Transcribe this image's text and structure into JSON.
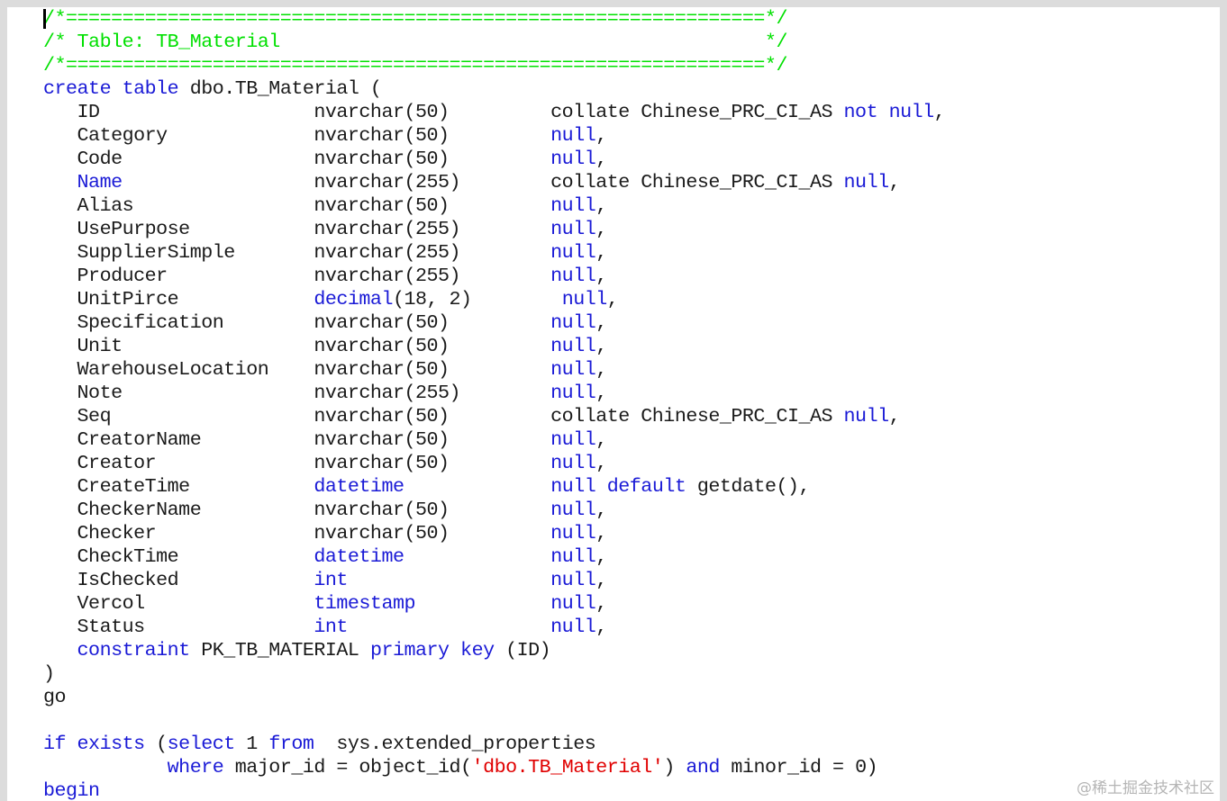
{
  "editor": {
    "watermark": "@稀土掘金技术社区"
  },
  "code_lines": [
    [
      {
        "t": "/*==============================================================*/",
        "c": "comment"
      }
    ],
    [
      {
        "t": "/* Table: TB_Material                                           */",
        "c": "comment"
      }
    ],
    [
      {
        "t": "/*==============================================================*/",
        "c": "comment"
      }
    ],
    [
      {
        "t": "create table",
        "c": "kw"
      },
      {
        "t": " dbo.TB_Material (",
        "c": ""
      }
    ],
    [
      {
        "t": "   ID                   nvarchar(50)         collate Chinese_PRC_CI_AS ",
        "c": ""
      },
      {
        "t": "not null",
        "c": "kw"
      },
      {
        "t": ",",
        "c": ""
      }
    ],
    [
      {
        "t": "   Category             nvarchar(50)         ",
        "c": ""
      },
      {
        "t": "null",
        "c": "kw"
      },
      {
        "t": ",",
        "c": ""
      }
    ],
    [
      {
        "t": "   Code                 nvarchar(50)         ",
        "c": ""
      },
      {
        "t": "null",
        "c": "kw"
      },
      {
        "t": ",",
        "c": ""
      }
    ],
    [
      {
        "t": "   ",
        "c": ""
      },
      {
        "t": "Name",
        "c": "kw"
      },
      {
        "t": "                 nvarchar(255)        collate Chinese_PRC_CI_AS ",
        "c": ""
      },
      {
        "t": "null",
        "c": "kw"
      },
      {
        "t": ",",
        "c": ""
      }
    ],
    [
      {
        "t": "   Alias                nvarchar(50)         ",
        "c": ""
      },
      {
        "t": "null",
        "c": "kw"
      },
      {
        "t": ",",
        "c": ""
      }
    ],
    [
      {
        "t": "   UsePurpose           nvarchar(255)        ",
        "c": ""
      },
      {
        "t": "null",
        "c": "kw"
      },
      {
        "t": ",",
        "c": ""
      }
    ],
    [
      {
        "t": "   SupplierSimple       nvarchar(255)        ",
        "c": ""
      },
      {
        "t": "null",
        "c": "kw"
      },
      {
        "t": ",",
        "c": ""
      }
    ],
    [
      {
        "t": "   Producer             nvarchar(255)        ",
        "c": ""
      },
      {
        "t": "null",
        "c": "kw"
      },
      {
        "t": ",",
        "c": ""
      }
    ],
    [
      {
        "t": "   UnitPirce            ",
        "c": ""
      },
      {
        "t": "decimal",
        "c": "kw"
      },
      {
        "t": "(18, 2)        ",
        "c": ""
      },
      {
        "t": "null",
        "c": "kw"
      },
      {
        "t": ",",
        "c": ""
      }
    ],
    [
      {
        "t": "   Specification        nvarchar(50)         ",
        "c": ""
      },
      {
        "t": "null",
        "c": "kw"
      },
      {
        "t": ",",
        "c": ""
      }
    ],
    [
      {
        "t": "   Unit                 nvarchar(50)         ",
        "c": ""
      },
      {
        "t": "null",
        "c": "kw"
      },
      {
        "t": ",",
        "c": ""
      }
    ],
    [
      {
        "t": "   WarehouseLocation    nvarchar(50)         ",
        "c": ""
      },
      {
        "t": "null",
        "c": "kw"
      },
      {
        "t": ",",
        "c": ""
      }
    ],
    [
      {
        "t": "   Note                 nvarchar(255)        ",
        "c": ""
      },
      {
        "t": "null",
        "c": "kw"
      },
      {
        "t": ",",
        "c": ""
      }
    ],
    [
      {
        "t": "   Seq                  nvarchar(50)         collate Chinese_PRC_CI_AS ",
        "c": ""
      },
      {
        "t": "null",
        "c": "kw"
      },
      {
        "t": ",",
        "c": ""
      }
    ],
    [
      {
        "t": "   CreatorName          nvarchar(50)         ",
        "c": ""
      },
      {
        "t": "null",
        "c": "kw"
      },
      {
        "t": ",",
        "c": ""
      }
    ],
    [
      {
        "t": "   Creator              nvarchar(50)         ",
        "c": ""
      },
      {
        "t": "null",
        "c": "kw"
      },
      {
        "t": ",",
        "c": ""
      }
    ],
    [
      {
        "t": "   CreateTime           ",
        "c": ""
      },
      {
        "t": "datetime",
        "c": "kw"
      },
      {
        "t": "             ",
        "c": ""
      },
      {
        "t": "null default",
        "c": "kw"
      },
      {
        "t": " getdate(),",
        "c": ""
      }
    ],
    [
      {
        "t": "   CheckerName          nvarchar(50)         ",
        "c": ""
      },
      {
        "t": "null",
        "c": "kw"
      },
      {
        "t": ",",
        "c": ""
      }
    ],
    [
      {
        "t": "   Checker              nvarchar(50)         ",
        "c": ""
      },
      {
        "t": "null",
        "c": "kw"
      },
      {
        "t": ",",
        "c": ""
      }
    ],
    [
      {
        "t": "   CheckTime            ",
        "c": ""
      },
      {
        "t": "datetime",
        "c": "kw"
      },
      {
        "t": "             ",
        "c": ""
      },
      {
        "t": "null",
        "c": "kw"
      },
      {
        "t": ",",
        "c": ""
      }
    ],
    [
      {
        "t": "   IsChecked            ",
        "c": ""
      },
      {
        "t": "int",
        "c": "kw"
      },
      {
        "t": "                  ",
        "c": ""
      },
      {
        "t": "null",
        "c": "kw"
      },
      {
        "t": ",",
        "c": ""
      }
    ],
    [
      {
        "t": "   Vercol               ",
        "c": ""
      },
      {
        "t": "timestamp",
        "c": "kw"
      },
      {
        "t": "            ",
        "c": ""
      },
      {
        "t": "null",
        "c": "kw"
      },
      {
        "t": ",",
        "c": ""
      }
    ],
    [
      {
        "t": "   Status               ",
        "c": ""
      },
      {
        "t": "int",
        "c": "kw"
      },
      {
        "t": "                  ",
        "c": ""
      },
      {
        "t": "null",
        "c": "kw"
      },
      {
        "t": ",",
        "c": ""
      }
    ],
    [
      {
        "t": "   ",
        "c": ""
      },
      {
        "t": "constraint",
        "c": "kw"
      },
      {
        "t": " PK_TB_MATERIAL ",
        "c": ""
      },
      {
        "t": "primary key",
        "c": "kw"
      },
      {
        "t": " (ID)",
        "c": ""
      }
    ],
    [
      {
        "t": ")",
        "c": ""
      }
    ],
    [
      {
        "t": "go",
        "c": ""
      }
    ],
    [
      {
        "t": "",
        "c": ""
      }
    ],
    [
      {
        "t": "if exists",
        "c": "kw"
      },
      {
        "t": " (",
        "c": ""
      },
      {
        "t": "select",
        "c": "kw"
      },
      {
        "t": " 1 ",
        "c": ""
      },
      {
        "t": "from",
        "c": "kw"
      },
      {
        "t": "  sys.extended_properties",
        "c": ""
      }
    ],
    [
      {
        "t": "           ",
        "c": ""
      },
      {
        "t": "where",
        "c": "kw"
      },
      {
        "t": " major_id = object_id(",
        "c": ""
      },
      {
        "t": "'dbo.TB_Material'",
        "c": "str"
      },
      {
        "t": ") ",
        "c": ""
      },
      {
        "t": "and",
        "c": "kw"
      },
      {
        "t": " minor_id = 0)",
        "c": ""
      }
    ],
    [
      {
        "t": "begin",
        "c": "kw"
      }
    ]
  ]
}
